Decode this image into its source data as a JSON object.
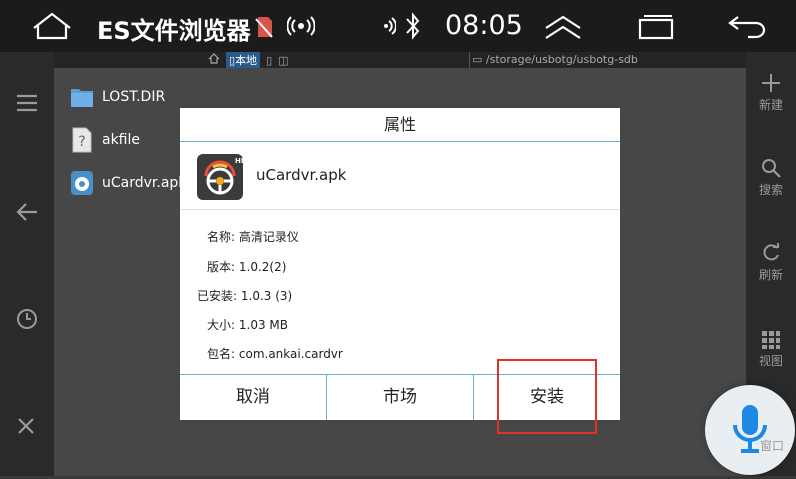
{
  "status_bar": {
    "app_title": "ES文件浏览器",
    "time": "08:05"
  },
  "path_bar": {
    "local_label": "本地",
    "path": "/storage/usbotg/usbotg-sdb"
  },
  "files": [
    {
      "name": "LOST.DIR",
      "icon": "folder-icon"
    },
    {
      "name": "akfile",
      "icon": "unknown-file-icon"
    },
    {
      "name": "uCardvr.apk",
      "icon": "apk-file-icon"
    }
  ],
  "right_toolbar": [
    {
      "label": "新建",
      "icon": "plus-icon"
    },
    {
      "label": "搜索",
      "icon": "search-icon"
    },
    {
      "label": "刷新",
      "icon": "refresh-icon"
    },
    {
      "label": "视图",
      "icon": "grid-view-icon"
    },
    {
      "label": "窗口",
      "icon": "window-icon"
    }
  ],
  "dialog": {
    "title": "属性",
    "app_name": "uCardvr.apk",
    "info": [
      {
        "key": "名称:",
        "value": "高清记录仪"
      },
      {
        "key": "版本:",
        "value": "1.0.2(2)"
      },
      {
        "key": "已安装:",
        "value": "1.0.3 (3)"
      },
      {
        "key": "大小:",
        "value": "1.03 MB"
      },
      {
        "key": "包名:",
        "value": "com.ankai.cardvr"
      }
    ],
    "buttons": {
      "cancel": "取消",
      "market": "市场",
      "install": "安装"
    }
  },
  "colors": {
    "dialog_divider": "#5fb8c8",
    "highlight_box": "#e0312b",
    "mic": "#1e88e5"
  }
}
